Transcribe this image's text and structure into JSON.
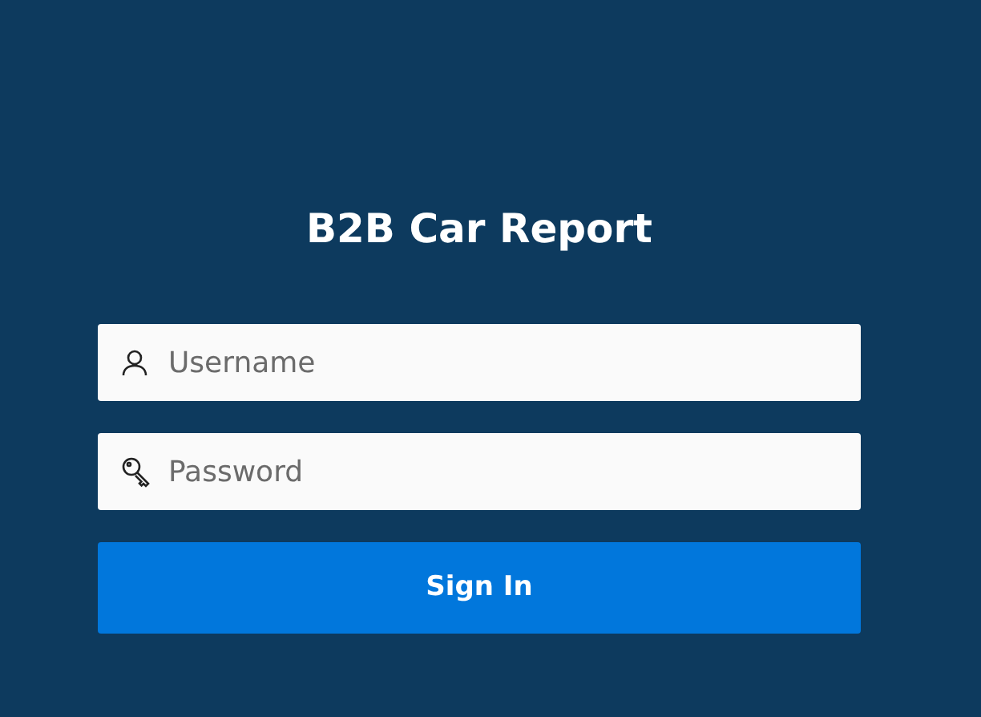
{
  "title": "B2B Car Report",
  "fields": [
    {
      "kind": "username",
      "placeholder": "Username"
    },
    {
      "kind": "password",
      "placeholder": "Password"
    }
  ],
  "submit": {
    "label": "Sign In"
  }
}
